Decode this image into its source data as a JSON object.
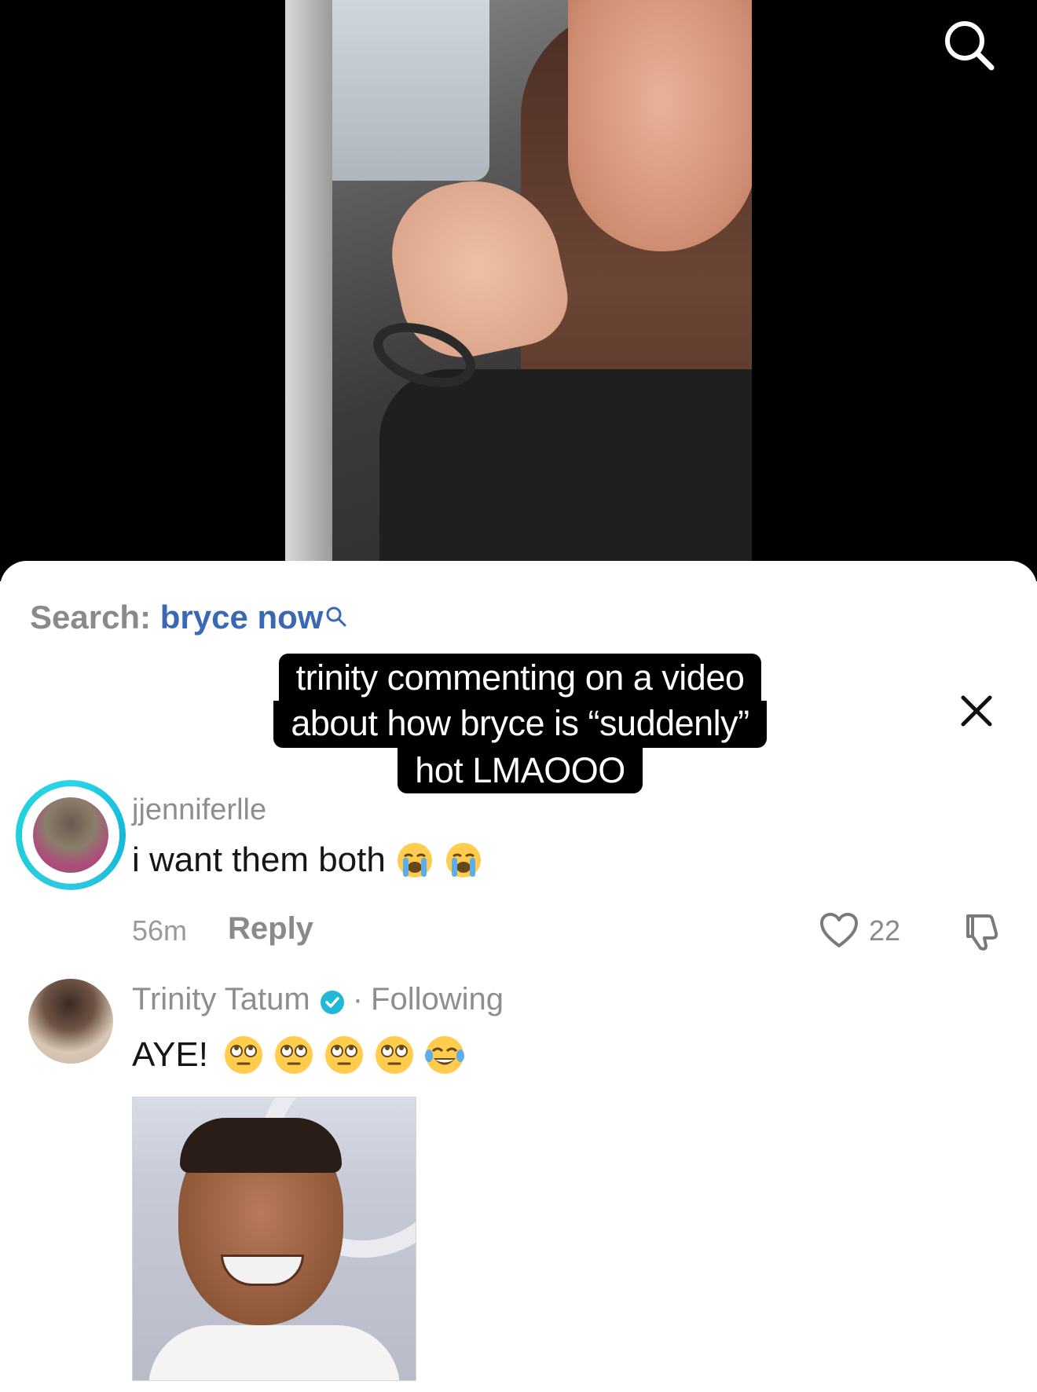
{
  "video": {
    "search_icon": "search-icon"
  },
  "search_bar": {
    "prefix": "Search:",
    "query": "bryce now",
    "icon": "mini-search-icon"
  },
  "caption": {
    "line1": "trinity commenting on a video",
    "line2": "about how bryce is “suddenly”",
    "line3": "hot LMAOOO"
  },
  "close": {
    "icon": "close-icon"
  },
  "comments": [
    {
      "username": "jjenniferlle",
      "text": "i want them both",
      "emoji": [
        "loudly-crying-face",
        "loudly-crying-face"
      ],
      "time": "56m",
      "reply_label": "Reply",
      "like_count": "22"
    }
  ],
  "reply": {
    "name": "Trinity Tatum",
    "separator": "·",
    "following_label": "Following",
    "text": "AYE!",
    "emoji": [
      "face-with-rolling-eyes",
      "face-with-rolling-eyes",
      "face-with-rolling-eyes",
      "face-with-rolling-eyes",
      "face-with-tears-of-joy"
    ]
  },
  "colors": {
    "query_link": "#3a68b2",
    "verified_badge": "#20b8d8",
    "story_ring": "#2bd5ea"
  }
}
